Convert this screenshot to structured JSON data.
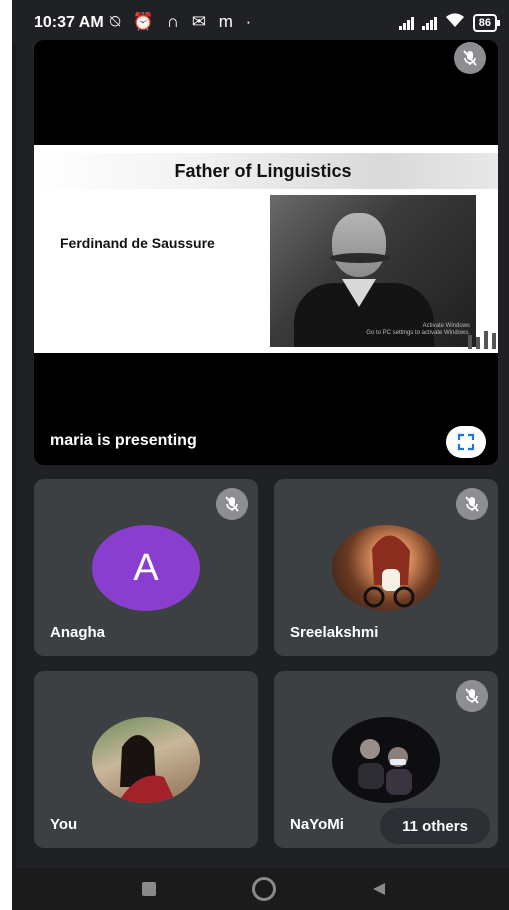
{
  "status_bar": {
    "time": "10:37 AM",
    "notification_icons": "⍉ ⏰ ∩ ✉ m ·",
    "battery": "86"
  },
  "presentation": {
    "slide": {
      "title": "Father of Linguistics",
      "name": "Ferdinand de Saussure",
      "watermark": "Activate Windows\nGo to PC settings to activate Windows."
    },
    "presenting_label": "maria is presenting"
  },
  "participants": [
    {
      "name": "Anagha",
      "avatar_letter": "A",
      "muted": true
    },
    {
      "name": "Sreelakshmi",
      "muted": true
    },
    {
      "name": "You",
      "muted": false
    },
    {
      "name": "NaYoMi",
      "muted": true
    }
  ],
  "others_label": "11 others",
  "colors": {
    "background": "#202124",
    "tile": "#3c4043",
    "avatar_purple": "#8a3ecf",
    "mic_badge": "#8e8e92"
  },
  "icons": {
    "mic_off": "mic-off-icon",
    "fullscreen": "fullscreen-icon",
    "nav_recent": "square-icon",
    "nav_home": "circle-icon",
    "nav_back": "triangle-icon"
  }
}
